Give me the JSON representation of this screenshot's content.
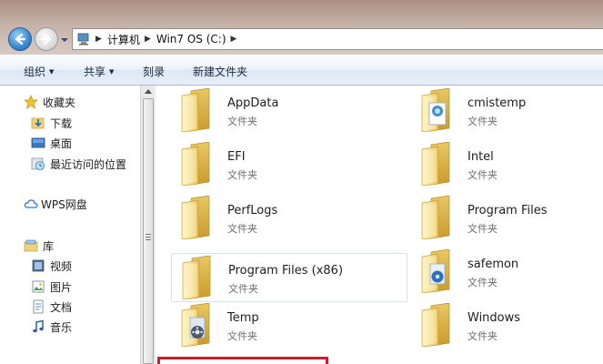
{
  "address": {
    "crumbs": [
      "计算机",
      "Win7 OS (C:)"
    ]
  },
  "toolbar": {
    "organize": "组织",
    "share": "共享",
    "burn": "刻录",
    "new_folder": "新建文件夹"
  },
  "nav": {
    "favorites": "收藏夹",
    "downloads": "下载",
    "desktop": "桌面",
    "recent": "最近访问的位置",
    "wps": "WPS网盘",
    "libraries": "库",
    "videos": "视频",
    "pictures": "图片",
    "documents": "文档",
    "music": "音乐"
  },
  "files": [
    {
      "name": "AppData",
      "type": "文件夹",
      "icon": "folder-icon"
    },
    {
      "name": "cmistemp",
      "type": "文件夹",
      "icon": "folder-document-icon"
    },
    {
      "name": "EFI",
      "type": "文件夹",
      "icon": "folder-icon"
    },
    {
      "name": "Intel",
      "type": "文件夹",
      "icon": "folder-icon"
    },
    {
      "name": "PerfLogs",
      "type": "文件夹",
      "icon": "folder-icon"
    },
    {
      "name": "Program Files",
      "type": "文件夹",
      "icon": "folder-icon"
    },
    {
      "name": "Program Files (x86)",
      "type": "文件夹",
      "icon": "folder-icon"
    },
    {
      "name": "safemon",
      "type": "文件夹",
      "icon": "folder-media-icon"
    },
    {
      "name": "Temp",
      "type": "文件夹",
      "icon": "folder-media-icon"
    },
    {
      "name": "Windows",
      "type": "文件夹",
      "icon": "folder-icon"
    }
  ],
  "colors": {
    "selection_border": "#d7e4f2",
    "highlight_mark": "#c8202a",
    "toolbar_border": "#a9bcd4"
  }
}
